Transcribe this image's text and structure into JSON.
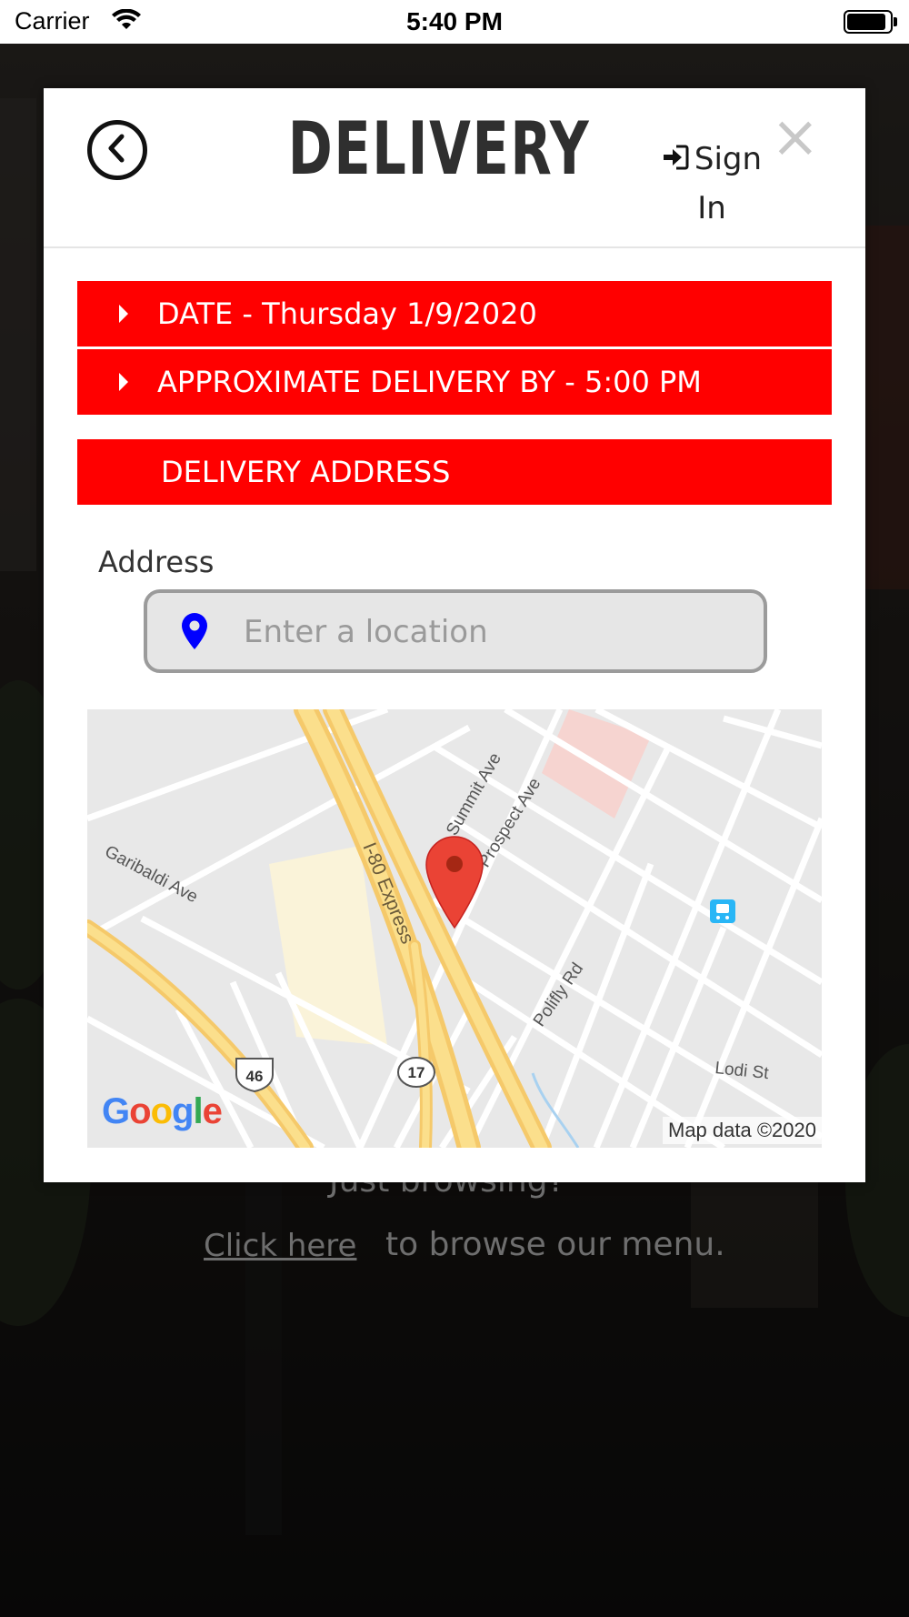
{
  "status_bar": {
    "carrier": "Carrier",
    "time": "5:40 PM"
  },
  "background": {
    "browsing_text": "Just browsing?",
    "click_here": "Click here",
    "browse_menu": "to browse our menu."
  },
  "modal": {
    "title": "DELIVERY",
    "sign_in": "Sign In",
    "close": "×",
    "date_bar": "DATE - Thursday 1/9/2020",
    "approx_bar": "APPROXIMATE DELIVERY BY - 5:00 PM",
    "address_bar": "DELIVERY ADDRESS",
    "address_label": "Address",
    "location_placeholder": "Enter a location",
    "location_value": ""
  },
  "map": {
    "streets": [
      "Garibaldi Ave",
      "I-80 Express",
      "Summit Ave",
      "Prospect Ave",
      "Polifly Rd",
      "Lodi St"
    ],
    "route_shields": [
      "46",
      "17"
    ],
    "logo": "Google",
    "attribution": "Map data ©2020"
  },
  "colors": {
    "accent_red": "#ff0000",
    "pin_blue": "#0000ff",
    "marker_red": "#ea4335"
  },
  "icons": {
    "back": "chevron-left-icon",
    "sign_in": "sign-in-icon",
    "close": "close-icon",
    "caret": "caret-right-icon",
    "location": "map-pin-icon",
    "map_marker": "map-marker-icon",
    "transit": "train-icon"
  }
}
